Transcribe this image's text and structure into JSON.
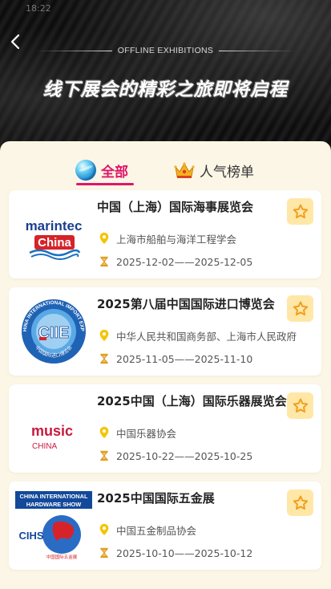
{
  "status_bar": {
    "time": "18:22"
  },
  "header": {
    "subtitle": "OFFLINE EXHIBITIONS",
    "title": "线下展会的精彩之旅即将启程"
  },
  "tabs": [
    {
      "label": "全部",
      "icon": "globe-icon",
      "active": true
    },
    {
      "label": "人气榜单",
      "icon": "crown-icon",
      "active": false
    }
  ],
  "exhibitions": [
    {
      "title": "中国（上海）国际海事展览会",
      "organizer": "上海市船舶与海洋工程学会",
      "dates": "2025-12-02——2025-12-05",
      "logo": {
        "line1": "marintec",
        "line2": "China"
      }
    },
    {
      "title": "2025第八届中国国际进口博览会",
      "organizer": "中华人民共和国商务部、上海市人民政府",
      "dates": "2025-11-05——2025-11-10",
      "logo": {
        "arc_top": "CHINA INTERNATIONAL IMPORT EXPO",
        "center": "CIIE",
        "arc_bottom": "中国国际进口博览会"
      }
    },
    {
      "title": "2025中国（上海）国际乐器展览会",
      "organizer": "中国乐器协会",
      "dates": "2025-10-22——2025-10-25",
      "logo": {
        "line1": "music",
        "line2": "CHINA"
      }
    },
    {
      "title": "2025中国国际五金展",
      "organizer": "中国五金制品协会",
      "dates": "2025-10-10——2025-10-12",
      "logo": {
        "banner1": "CHINA INTERNATIONAL",
        "banner2": "HARDWARE SHOW",
        "center": "CIHS",
        "sub": "中国国际五金展"
      }
    }
  ],
  "colors": {
    "accent": "#e0156a",
    "panel_bg": "#fcf6e6",
    "star_bg": "#ffe7a8",
    "star": "#f0a01e",
    "pin": "#f5c400",
    "hourglass": "#e8a32a"
  }
}
